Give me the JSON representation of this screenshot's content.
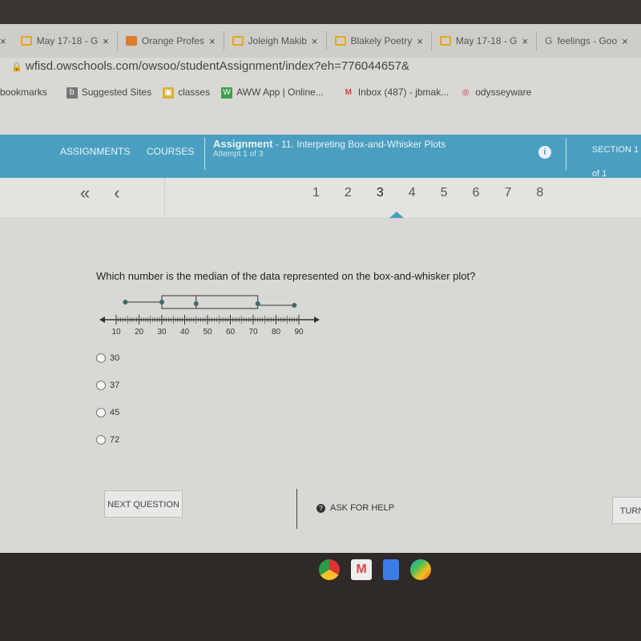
{
  "browser": {
    "tabs": [
      {
        "label": "May 17-18 - G"
      },
      {
        "label": "Orange Profes"
      },
      {
        "label": "Joleigh Makib"
      },
      {
        "label": "Blakely Poetry"
      },
      {
        "label": "May 17-18 - G"
      },
      {
        "label": "feelings - Goo"
      }
    ],
    "close_glyph": "×",
    "url": "wfisd.owschools.com/owsoo/studentAssignment/index?eh=776044657&",
    "bookmarks": [
      {
        "label": "bookmarks",
        "icon": ""
      },
      {
        "label": "Suggested Sites",
        "icon": "b"
      },
      {
        "label": "classes",
        "icon": "▣"
      },
      {
        "label": "AWW App | Online...",
        "icon": "W"
      },
      {
        "label": "Inbox (487) - jbmak...",
        "icon": "M"
      },
      {
        "label": "odysseyware",
        "icon": "◎"
      }
    ]
  },
  "header": {
    "nav": [
      "ASSIGNMENTS",
      "COURSES"
    ],
    "assignment_label": "Assignment",
    "assignment_title": " - 11. Interpreting Box-and-Whisker Plots",
    "attempt": "Attempt 1 of 3",
    "info_icon": "i",
    "section": "SECTION 1 of 1"
  },
  "pager": {
    "first": "«",
    "prev": "‹",
    "pages": [
      "1",
      "2",
      "3",
      "4",
      "5",
      "6",
      "7",
      "8"
    ],
    "current": "3"
  },
  "question": {
    "text": "Which number is the median of the data represented on the box-and-whisker plot?",
    "options": [
      "30",
      "37",
      "45",
      "72"
    ]
  },
  "chart_data": {
    "type": "boxplot",
    "min": 14,
    "q1": 30,
    "median": 45,
    "q3": 72,
    "max": 88,
    "xlim": [
      10,
      90
    ],
    "tick_labels": [
      "10",
      "20",
      "30",
      "40",
      "50",
      "60",
      "70",
      "80",
      "90"
    ],
    "minor_tick_step": 1,
    "color": "#3d6b68"
  },
  "footer": {
    "next": "NEXT QUESTION",
    "help": "ASK FOR HELP",
    "help_icon": "?",
    "turn_in": "TURN"
  }
}
